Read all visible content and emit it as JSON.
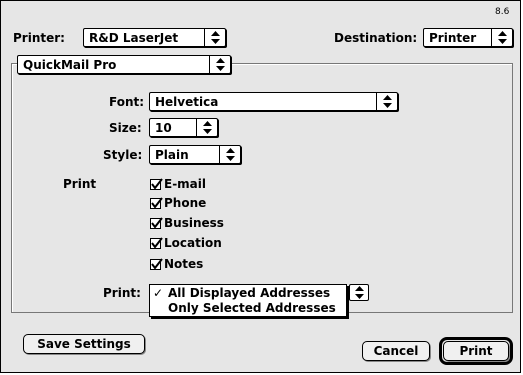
{
  "version": "8.6",
  "header": {
    "printer_label": "Printer:",
    "printer_value": "R&D LaserJet",
    "destination_label": "Destination:",
    "destination_value": "Printer"
  },
  "panel": {
    "plugin_value": "QuickMail Pro",
    "font_label": "Font:",
    "font_value": "Helvetica",
    "size_label": "Size:",
    "size_value": "10",
    "style_label": "Style:",
    "style_value": "Plain",
    "print_group_label": "Print",
    "checkboxes": [
      {
        "label": "E-mail",
        "checked": true
      },
      {
        "label": "Phone",
        "checked": true
      },
      {
        "label": "Business",
        "checked": true
      },
      {
        "label": "Location",
        "checked": true
      },
      {
        "label": "Notes",
        "checked": true
      }
    ],
    "print_scope_label": "Print:",
    "print_scope_options": [
      {
        "label": "All Displayed Addresses",
        "selected": true,
        "checkmark": "✓"
      },
      {
        "label": "Only Selected Addresses",
        "selected": false,
        "checkmark": ""
      }
    ]
  },
  "buttons": {
    "save_settings": "Save Settings",
    "cancel": "Cancel",
    "print": "Print"
  }
}
